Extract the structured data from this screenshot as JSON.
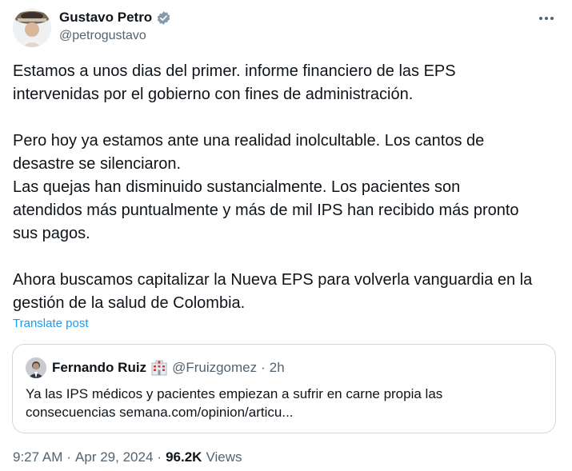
{
  "author": {
    "display_name": "Gustavo Petro",
    "handle": "@petrogustavo",
    "verified_icon": "verified-badge-icon",
    "badge_color": "#829aab"
  },
  "post": {
    "paragraph_1_line_1": "Estamos a unos dias del primer. informe financiero de las EPS",
    "paragraph_1_line_2": "intervenidas por el gobierno con fines de administración.",
    "paragraph_2_line_1": "Pero hoy ya estamos ante una realidad inolcultable. Los cantos de",
    "paragraph_2_line_2": "desastre se silenciaron.",
    "paragraph_3_line_1": "Las quejas han disminuido sustancialmente. Los pacientes son",
    "paragraph_3_line_2": "atendidos más puntualmente y más de mil IPS han recibido más pronto",
    "paragraph_3_line_3": "sus pagos.",
    "paragraph_4_line_1": "Ahora buscamos capitalizar la Nueva EPS para volverla vanguardia en la",
    "paragraph_4_line_2": "gestión de la salud de Colombia."
  },
  "translate_label": "Translate post",
  "quoted_post": {
    "display_name": "Fernando Ruiz",
    "emoji_icon": "hospital-building-icon",
    "handle": "@Fruizgomez",
    "separator": "·",
    "time": "2h",
    "text_line_1": "Ya las IPS médicos y pacientes empiezan a sufrir en carne propia las",
    "text_line_2": "consecuencias semana.com/opinion/articu..."
  },
  "meta": {
    "time": "9:27 AM",
    "separator_1": "·",
    "date": "Apr 29, 2024",
    "separator_2": "·",
    "views_count": "96.2K",
    "views_label": "Views"
  },
  "colors": {
    "link": "#1d9bf0",
    "secondary_text": "#536471",
    "primary_text": "#0f1419",
    "border": "#cfd9de"
  }
}
